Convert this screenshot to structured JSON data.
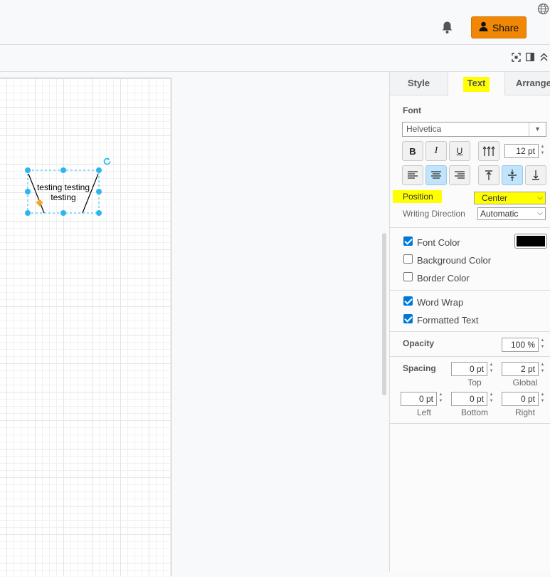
{
  "header": {
    "share_label": "Share",
    "share_color": "#f08705",
    "icons": [
      "globe-icon",
      "bell-icon",
      "user-icon"
    ]
  },
  "toolbar": {
    "icons": [
      "fullscreen-icon",
      "format-panel-icon",
      "collapse-icon"
    ]
  },
  "diagram": {
    "shape_text_line1": "testing testing",
    "shape_text_line2": "testing"
  },
  "panel": {
    "tabs": [
      {
        "label": "Style"
      },
      {
        "label": "Text"
      },
      {
        "label": "Arrange"
      }
    ],
    "active_tab": "Text",
    "font_heading": "Font",
    "font_family": "Helvetica",
    "font_size": "12 pt",
    "style_buttons": [
      "B",
      "I",
      "U"
    ],
    "position_label": "Position",
    "position_value": "Center",
    "position_options": [
      "Center"
    ],
    "writing_direction_label": "Writing Direction",
    "writing_direction_value": "Automatic",
    "writing_direction_options": [
      "Automatic"
    ],
    "font_color_label": "Font Color",
    "font_color_checked": true,
    "font_color_value": "#000000",
    "background_color_label": "Background Color",
    "background_color_checked": false,
    "border_color_label": "Border Color",
    "border_color_checked": false,
    "word_wrap_label": "Word Wrap",
    "word_wrap_checked": true,
    "formatted_text_label": "Formatted Text",
    "formatted_text_checked": true,
    "opacity_label": "Opacity",
    "opacity_value": "100 %",
    "spacing_label": "Spacing",
    "spacing_top": "0 pt",
    "spacing_global": "2 pt",
    "spacing_left": "0 pt",
    "spacing_bottom": "0 pt",
    "spacing_right": "0 pt",
    "spacing_top_caption": "Top",
    "spacing_global_caption": "Global",
    "spacing_left_caption": "Left",
    "spacing_bottom_caption": "Bottom",
    "spacing_right_caption": "Right"
  }
}
